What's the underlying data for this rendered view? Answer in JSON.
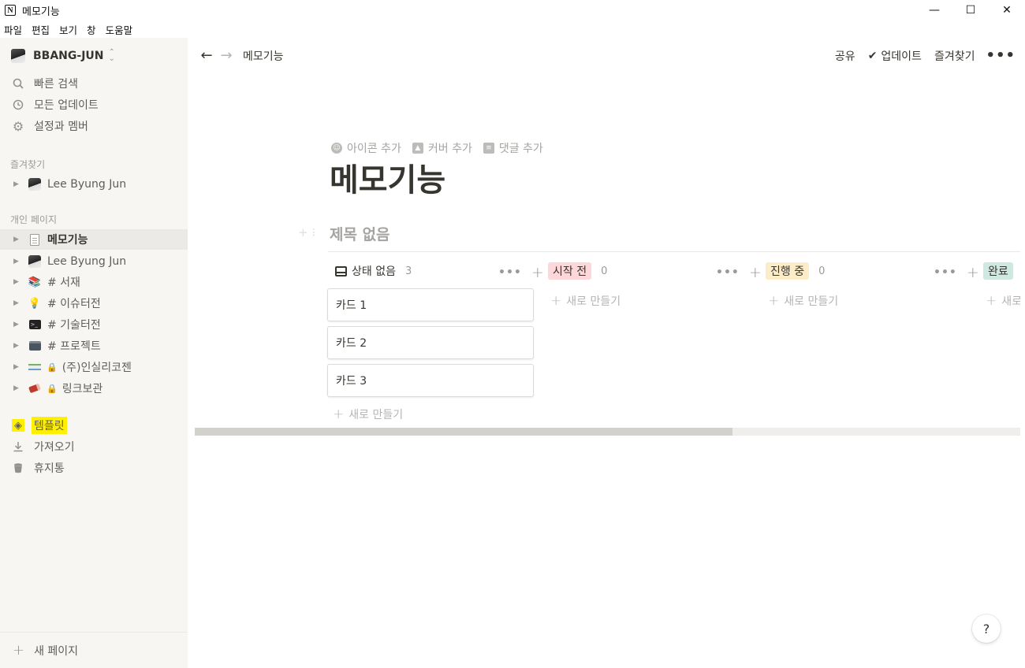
{
  "window": {
    "title": "메모기능",
    "app_icon": "N",
    "controls": {
      "minimize": "—",
      "maximize": "☐",
      "close": "✕"
    }
  },
  "menubar": [
    "파일",
    "편집",
    "보기",
    "창",
    "도움말"
  ],
  "sidebar": {
    "workspace_name": "BBANG-JUN",
    "quick_items": [
      {
        "label": "빠른 검색",
        "icon": "search-icon"
      },
      {
        "label": "모든 업데이트",
        "icon": "clock-icon"
      },
      {
        "label": "설정과 멤버",
        "icon": "gear-icon"
      }
    ],
    "favorites_heading": "즐겨찾기",
    "favorites": [
      {
        "label": "Lee Byung Jun",
        "icon": "avatar"
      }
    ],
    "private_heading": "개인 페이지",
    "pages": [
      {
        "label": "메모기능",
        "icon": "document-icon",
        "active": true
      },
      {
        "label": "Lee Byung Jun",
        "icon": "avatar"
      },
      {
        "label": "# 서재",
        "icon": "books-icon"
      },
      {
        "label": "# 이슈터전",
        "icon": "lightbulb-icon"
      },
      {
        "label": "# 기술터전",
        "icon": "terminal-icon"
      },
      {
        "label": "# 프로젝트",
        "icon": "project-icon"
      },
      {
        "label": "(주)인실리코젠",
        "icon": "company-logo",
        "locked": true
      },
      {
        "label": "링크보관",
        "icon": "eraser-icon",
        "locked": true
      }
    ],
    "tools": [
      {
        "label": "템플릿",
        "icon": "template-icon",
        "highlight": "#ffef00"
      },
      {
        "label": "가져오기",
        "icon": "download-icon"
      },
      {
        "label": "휴지통",
        "icon": "trash-icon"
      }
    ],
    "new_page_label": "새 페이지"
  },
  "topbar": {
    "breadcrumb": "메모기능",
    "share_label": "공유",
    "updates_label": "업데이트",
    "favorite_label": "즐겨찾기",
    "more_label": "•••"
  },
  "page": {
    "actions": [
      {
        "label": "아이콘 추가",
        "icon": "smile-icon"
      },
      {
        "label": "커버 추가",
        "icon": "image-icon"
      },
      {
        "label": "댓글 추가",
        "icon": "comment-icon"
      }
    ],
    "title": "메모기능",
    "view_title": "제목 없음"
  },
  "board": {
    "columns": [
      {
        "name": "상태 없음",
        "count": "3",
        "tag_color": "transparent",
        "cards": [
          "카드 1",
          "카드 2",
          "카드 3"
        ],
        "new_label": "새로 만들기"
      },
      {
        "name": "시작 전",
        "count": "0",
        "tag_color": "#fdd7d9",
        "cards": [],
        "new_label": "새로 만들기"
      },
      {
        "name": "진행 중",
        "count": "0",
        "tag_color": "#fdecc8",
        "cards": [],
        "new_label": "새로 만들기"
      },
      {
        "name": "완료",
        "count": "",
        "tag_color": "#cfe8e2",
        "cards": [],
        "new_label": "새로"
      }
    ],
    "horizontal_scroll_fraction": 0.65
  },
  "help_label": "?"
}
